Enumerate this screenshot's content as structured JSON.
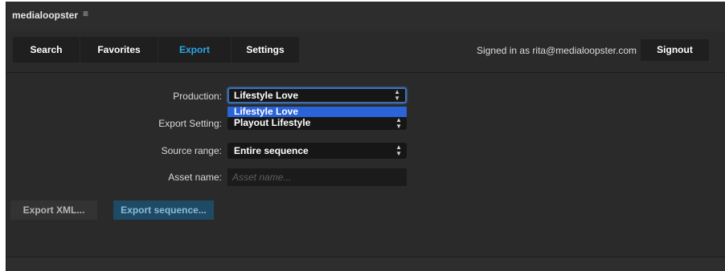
{
  "app": {
    "title": "medialoopster",
    "menu_icon": "hamburger-icon"
  },
  "nav": {
    "tabs": [
      {
        "label": "Search",
        "active": false
      },
      {
        "label": "Favorites",
        "active": false
      },
      {
        "label": "Export",
        "active": true
      },
      {
        "label": "Settings",
        "active": false
      }
    ]
  },
  "user": {
    "signed_in_text": "Signed in as rita@medialoopster.com",
    "signout_label": "Signout"
  },
  "form": {
    "production": {
      "label": "Production:",
      "value": "Lifestyle Love",
      "dropdown_option": "Lifestyle Love"
    },
    "export_setting": {
      "label": "Export Setting:",
      "value": "Playout Lifestyle"
    },
    "source_range": {
      "label": "Source range:",
      "value": "Entire sequence"
    },
    "asset_name": {
      "label": "Asset name:",
      "placeholder": "Asset name..."
    }
  },
  "actions": {
    "export_xml_label": "Export XML...",
    "export_sequence_label": "Export sequence..."
  },
  "colors": {
    "background": "#2a2a2a",
    "tab_background": "#1f1f1f",
    "active_tab_text": "#2aa6e6",
    "dropdown_highlight": "#2b63d8",
    "primary_button": "#1e4a66"
  }
}
